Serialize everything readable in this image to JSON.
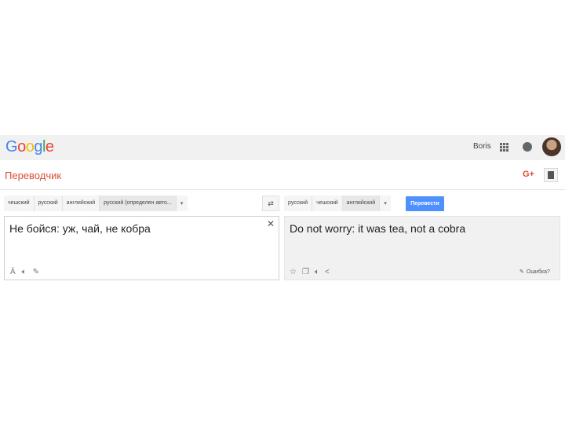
{
  "header": {
    "logo_text": "Google",
    "user_name": "Boris",
    "icons": [
      "apps-icon",
      "notifications-icon",
      "avatar"
    ]
  },
  "app": {
    "title": "Переводчик",
    "gplus_label": "G+"
  },
  "source": {
    "languages": [
      "чешский",
      "русский",
      "английский",
      "русский (определен авто..."
    ],
    "selected_index": 3,
    "text": "Не бойся: уж, чай, не кобра",
    "clear_icon": "✕",
    "tools": [
      "font-icon",
      "listen-icon",
      "handwriting-icon"
    ]
  },
  "target": {
    "languages": [
      "русский",
      "чешский",
      "английский"
    ],
    "selected_index": 2,
    "translate_label": "Перевести",
    "text": "Do not worry: it was tea, not a cobra",
    "tools": [
      "star-icon",
      "copy-icon",
      "listen-icon",
      "share-icon"
    ],
    "feedback_label": "Ошибка?"
  },
  "colors": {
    "google_blue": "#4285f4",
    "google_red": "#ea4335",
    "google_yellow": "#fbbc05",
    "google_green": "#34a853",
    "title_red": "#dd4b39",
    "button_blue": "#4d90fe"
  }
}
